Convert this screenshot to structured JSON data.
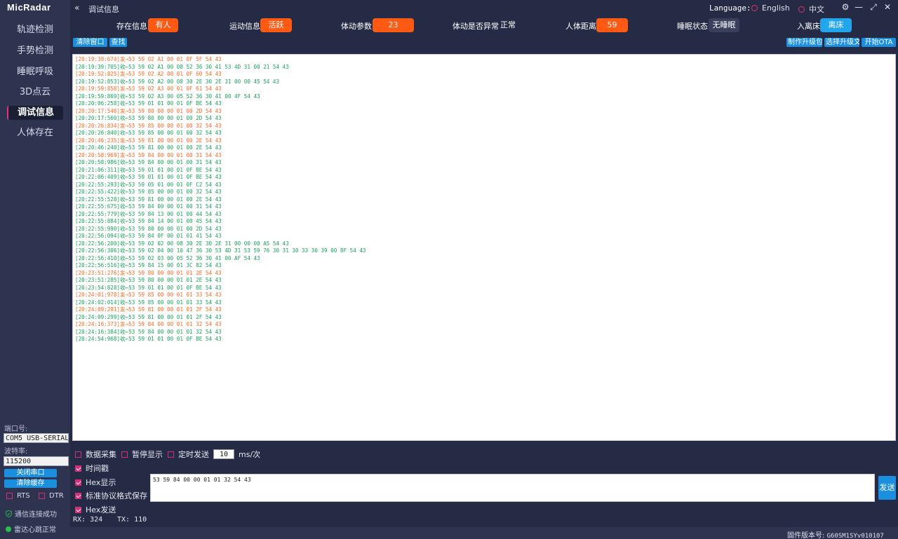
{
  "app": {
    "logo": "MicRadar",
    "title": "调试信息",
    "collapse_glyph": "«"
  },
  "language": {
    "label": "Language:",
    "options": [
      "English",
      "中文"
    ]
  },
  "window_controls": {
    "settings": "⚙",
    "minimize": "—",
    "fullscreen": "⤢",
    "close": "✕"
  },
  "sidebar": {
    "items": [
      {
        "label": "轨迹检测"
      },
      {
        "label": "手势检测"
      },
      {
        "label": "睡眠呼吸"
      },
      {
        "label": "3D点云"
      },
      {
        "label": "调试信息"
      },
      {
        "label": "人体存在"
      }
    ],
    "active_index": 4,
    "port_label": "端口号:",
    "port_value": "COM5 USB-SERIAL",
    "baud_label": "波特率:",
    "baud_value": "115200",
    "close_port": "关闭串口",
    "clear_cache": "清除缓存",
    "rts": "RTS",
    "dtr": "DTR",
    "status_conn": "通信连接成功",
    "status_heartbeat": "雷达心跳正常"
  },
  "status": [
    {
      "label": "存在信息",
      "value": "有人"
    },
    {
      "label": "运动信息",
      "value": "活跃"
    },
    {
      "label": "体动参数",
      "value": "23"
    },
    {
      "label": "体动是否异常",
      "value": "正常"
    },
    {
      "label": "人体距离",
      "value": "59"
    },
    {
      "label": "睡眠状态",
      "value": "无睡眠"
    },
    {
      "label": "入离床",
      "value": "离床"
    }
  ],
  "toolbar": {
    "clear_window": "清除窗口",
    "find": "查找",
    "make_upgrade": "制作升级包",
    "select_upgrade": "选择升级文件",
    "start_ota": "开始OTA"
  },
  "log": [
    {
      "dir": "sent",
      "text": "[20:19:39:674]发→53 59 02 A1 00 01 0F 5F 54 43"
    },
    {
      "dir": "recv",
      "text": "[20:19:39:705]收←53 59 02 A1 00 08 52 36 30 41 53 4D 31 00 21 54 43"
    },
    {
      "dir": "sent",
      "text": "[20:19:52:825]发→53 59 02 A2 00 01 0F 60 54 43"
    },
    {
      "dir": "recv",
      "text": "[20:19:52:853]收←53 59 02 A2 00 08 30 2E 30 2E 31 00 00 45 54 43"
    },
    {
      "dir": "sent",
      "text": "[20:19:59:858]发→53 59 02 A3 00 01 0F 61 54 43"
    },
    {
      "dir": "recv",
      "text": "[20:19:59:869]收←53 59 02 A3 00 05 52 36 30 41 00 4F 54 43"
    },
    {
      "dir": "recv",
      "text": "[20:20:06:258]收←53 59 01 01 00 01 0F BE 54 43"
    },
    {
      "dir": "sent",
      "text": "[20:20:17:546]发→53 59 80 00 00 01 00 2D 54 43"
    },
    {
      "dir": "recv",
      "text": "[20:20:17:560]收←53 59 80 00 00 01 00 2D 54 43"
    },
    {
      "dir": "sent",
      "text": "[20:20:26:834]发→53 59 85 00 00 01 00 32 54 43"
    },
    {
      "dir": "recv",
      "text": "[20:20:26:840]收←53 59 85 00 00 01 00 32 54 43"
    },
    {
      "dir": "sent",
      "text": "[20:20:46:235]发→53 59 81 00 00 01 00 2E 54 43"
    },
    {
      "dir": "recv",
      "text": "[20:20:46:240]收←53 59 81 00 00 01 00 2E 54 43"
    },
    {
      "dir": "sent",
      "text": "[20:20:58:969]发→53 59 84 00 00 01 00 31 54 43"
    },
    {
      "dir": "recv",
      "text": "[20:20:58:986]收←53 59 84 00 00 01 00 31 54 43"
    },
    {
      "dir": "recv",
      "text": "[20:21:06:311]收←53 59 01 01 00 01 0F BE 54 43"
    },
    {
      "dir": "recv",
      "text": "[20:22:06:409]收←53 59 01 01 00 01 0F BE 54 43"
    },
    {
      "dir": "recv",
      "text": "[20:22:55:293]收←53 59 05 01 00 01 0F C2 54 43"
    },
    {
      "dir": "recv",
      "text": "[20:22:55:422]收←53 59 85 00 00 01 00 32 54 43"
    },
    {
      "dir": "recv",
      "text": "[20:22:55:528]收←53 59 81 00 00 01 00 2E 54 43"
    },
    {
      "dir": "recv",
      "text": "[20:22:55:675]收←53 59 84 00 00 01 00 31 54 43"
    },
    {
      "dir": "recv",
      "text": "[20:22:55:779]收←53 59 84 13 00 01 00 44 54 43"
    },
    {
      "dir": "recv",
      "text": "[20:22:55:884]收←53 59 84 14 00 01 00 45 54 43"
    },
    {
      "dir": "recv",
      "text": "[20:22:55:990]收←53 59 80 00 00 01 00 2D 54 43"
    },
    {
      "dir": "recv",
      "text": "[20:22:56:094]收←53 59 84 0F 00 01 01 41 54 43"
    },
    {
      "dir": "recv",
      "text": "[20:22:56:200]收←53 59 02 02 00 08 30 2E 30 2E 31 00 00 00 A5 54 43"
    },
    {
      "dir": "recv",
      "text": "[20:22:56:306]收←53 59 02 04 00 10 47 36 30 53 4D 31 53 59 76 30 31 30 33 30 39 00 8F 54 43"
    },
    {
      "dir": "recv",
      "text": "[20:22:56:410]收←53 59 02 03 00 05 52 36 30 41 00 AF 54 43"
    },
    {
      "dir": "recv",
      "text": "[20:22:56:516]收←53 59 84 15 00 01 3C 82 54 43"
    },
    {
      "dir": "sent",
      "text": "[20:23:51:276]发→53 59 80 00 00 01 01 2E 54 43"
    },
    {
      "dir": "recv",
      "text": "[20:23:51:285]收←53 59 80 00 00 01 01 2E 54 43"
    },
    {
      "dir": "recv",
      "text": "[20:23:54:828]收←53 59 01 01 00 01 0F BE 54 43"
    },
    {
      "dir": "sent",
      "text": "[20:24:01:978]发→53 59 85 00 00 01 01 33 54 43"
    },
    {
      "dir": "recv",
      "text": "[20:24:02:014]收←53 59 85 00 00 01 01 33 54 43"
    },
    {
      "dir": "sent",
      "text": "[20:24:09:291]发→53 59 81 00 00 01 01 2F 54 43"
    },
    {
      "dir": "recv",
      "text": "[20:24:09:299]收←53 59 81 00 00 01 01 2F 54 43"
    },
    {
      "dir": "sent",
      "text": "[20:24:16:373]发→53 59 84 00 00 01 01 32 54 43"
    },
    {
      "dir": "recv",
      "text": "[20:24:16:384]收←53 59 84 00 00 01 01 32 54 43"
    },
    {
      "dir": "recv",
      "text": "[20:24:54:968]收←53 59 01 01 00 01 0F BE 54 43"
    }
  ],
  "options": {
    "data_collect": "数据采集",
    "pause_display": "暂停显示",
    "timed_send": "定时发送",
    "interval_value": "10",
    "interval_unit": "ms/次",
    "timestamp": "时间戳",
    "hex_display": "Hex显示",
    "std_save": "标准协议格式保存",
    "hex_send": "Hex发送"
  },
  "send": {
    "input_value": "53 59 84 00 00 01 01 32 54 43",
    "button": "发送"
  },
  "counters": {
    "rx_label": "RX:",
    "rx_value": "324",
    "tx_label": "TX:",
    "tx_value": "110"
  },
  "firmware": {
    "label": "固件版本号:",
    "value": "G60SM1SYv010107"
  },
  "colors": {
    "sent": "#ff6a20",
    "recv": "#1aa35b",
    "accent_orange": "#ff5a14",
    "accent_blue": "#23a5ec",
    "checkbox": "#d4307a"
  }
}
